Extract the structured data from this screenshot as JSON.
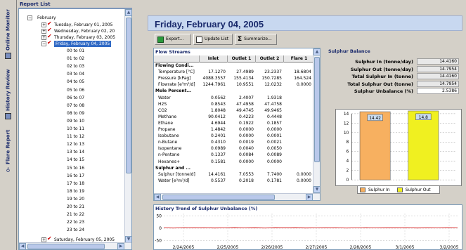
{
  "sidebar": {
    "tabs": [
      {
        "label": "Online Monitor",
        "icon": "monitor-icon"
      },
      {
        "label": "History Review",
        "icon": "history-icon"
      },
      {
        "label": "Flare Report",
        "icon": "search-icon"
      }
    ]
  },
  "tree": {
    "title": "Report List",
    "month": "February",
    "days": [
      {
        "label": "Tuesday, February 01, 2005"
      },
      {
        "label": "Wednesday, February 02, 20"
      },
      {
        "label": "Thursday, February 03, 2005"
      },
      {
        "label": "Friday, February 04, 2005"
      }
    ],
    "hours": [
      "00 to 01",
      "01 to 02",
      "02 to 03",
      "03 to 04",
      "04 to 05",
      "05 to 06",
      "06 to 07",
      "07 to 08",
      "08 to 09",
      "09 to 10",
      "10 to 11",
      "11 to 12",
      "12 to 13",
      "13 to 14",
      "14 to 15",
      "15 to 16",
      "16 to 17",
      "17 to 18",
      "18 to 19",
      "19 to 20",
      "20 to 21",
      "21 to 22",
      "22 to 23",
      "23 to 24"
    ],
    "last_day": "Saturday, February 05, 2005"
  },
  "main": {
    "date_title": "Friday, February 04, 2005",
    "buttons": {
      "export": "Export...",
      "update": "Update List",
      "summarize": "Summarize..."
    }
  },
  "flow": {
    "title": "Flow Streams",
    "columns": [
      "",
      "Inlet",
      "Outlet 1",
      "Outlet 2",
      "Flare 1"
    ],
    "rows": [
      {
        "label": "Flowing Condi...",
        "bold": true,
        "values": [
          "",
          "",
          "",
          ""
        ]
      },
      {
        "label": "Temperature [°C]",
        "values": [
          "17.1270",
          "27.4989",
          "23.2337",
          "18.6804"
        ]
      },
      {
        "label": "Pressure [kPag]",
        "values": [
          "4088.3557",
          "155.4134",
          "150.7285",
          "164.524"
        ]
      },
      {
        "label": "Flowrate [e³m³/d]",
        "values": [
          "1244.7961",
          "10.9551",
          "12.0232",
          "0.0000"
        ]
      },
      {
        "label": "Mole Percent...",
        "bold": true,
        "values": [
          "",
          "",
          "",
          ""
        ]
      },
      {
        "label": "Water",
        "values": [
          "0.0562",
          "2.4007",
          "1.9318",
          ""
        ]
      },
      {
        "label": "H2S",
        "values": [
          "0.8543",
          "47.4958",
          "47.4758",
          ""
        ]
      },
      {
        "label": "CO2",
        "values": [
          "1.8048",
          "49.4745",
          "49.9465",
          ""
        ]
      },
      {
        "label": "Methane",
        "values": [
          "90.0412",
          "0.4223",
          "0.4448",
          ""
        ]
      },
      {
        "label": "Ethane",
        "values": [
          "4.6944",
          "0.1922",
          "0.1857",
          ""
        ]
      },
      {
        "label": "Propane",
        "values": [
          "1.4842",
          "0.0000",
          "0.0000",
          ""
        ]
      },
      {
        "label": "Isobutane",
        "values": [
          "0.2401",
          "0.0000",
          "0.0001",
          ""
        ]
      },
      {
        "label": "n-Butane",
        "values": [
          "0.4310",
          "0.0019",
          "0.0021",
          ""
        ]
      },
      {
        "label": "Isopentane",
        "values": [
          "0.0989",
          "0.0040",
          "0.0050",
          ""
        ]
      },
      {
        "label": "n-Pentane",
        "values": [
          "0.1337",
          "0.0084",
          "0.0089",
          ""
        ]
      },
      {
        "label": "Hexanes+",
        "values": [
          "0.1581",
          "0.0000",
          "0.0000",
          ""
        ]
      },
      {
        "label": "Sulphur and ...",
        "bold": true,
        "values": [
          "",
          "",
          "",
          ""
        ]
      },
      {
        "label": "Sulphur [tonne/d]",
        "values": [
          "14.4161",
          "7.0553",
          "7.7400",
          "0.0000"
        ]
      },
      {
        "label": "Water [e³m³/d]",
        "values": [
          "0.5537",
          "0.2018",
          "0.1781",
          "0.0000"
        ]
      }
    ]
  },
  "sulphur": {
    "title": "Sulphur Balance",
    "rows": [
      {
        "label": "Sulphur In (tonne/day)",
        "value": "14.4160"
      },
      {
        "label": "Sulphur Out (tonne/day)",
        "value": "14.7954"
      },
      {
        "label": "Total Sulphur In (tonne)",
        "value": "14.4160"
      },
      {
        "label": "Total Sulphur Out (tonne)",
        "value": "14.7954"
      },
      {
        "label": "Sulphur Unbalance (%)",
        "value": "2.5386"
      }
    ]
  },
  "chart_data": [
    {
      "type": "bar",
      "categories": [
        "Sulphur In",
        "Sulphur Out"
      ],
      "values": [
        14.42,
        14.8
      ],
      "data_labels": [
        "14.42",
        "14.8"
      ],
      "ylim": [
        0,
        14
      ],
      "yticks": [
        0,
        2,
        4,
        6,
        8,
        10,
        12,
        14
      ],
      "colors": [
        "#f7b060",
        "#f0f020"
      ],
      "legend": [
        "Sulphur In",
        "Sulphur Out"
      ],
      "legend_position": "bottom",
      "grid": true
    },
    {
      "type": "line",
      "title": "History Trend of Sulphur Unbalance (%)",
      "x_ticks": [
        "2/24/2005",
        "2/25/2005",
        "2/26/2005",
        "2/27/2005",
        "2/28/2005",
        "3/1/2005",
        "3/2/2005"
      ],
      "yticks": [
        50,
        0,
        -50
      ],
      "ylim": [
        -60,
        60
      ],
      "color": "#d00000",
      "series": [
        {
          "values": [
            1.5,
            0.8,
            2.1,
            1.2,
            1.8,
            0.9,
            1.4,
            2.3,
            1.1,
            1.6,
            0.7,
            1.9,
            1.3,
            2.0,
            0.9,
            1.5,
            1.2,
            1.7,
            0.8,
            1.4,
            2.2,
            1.0,
            1.6,
            1.3,
            1.8,
            0.9,
            1.5,
            1.1,
            2.0,
            1.4
          ]
        }
      ]
    }
  ]
}
